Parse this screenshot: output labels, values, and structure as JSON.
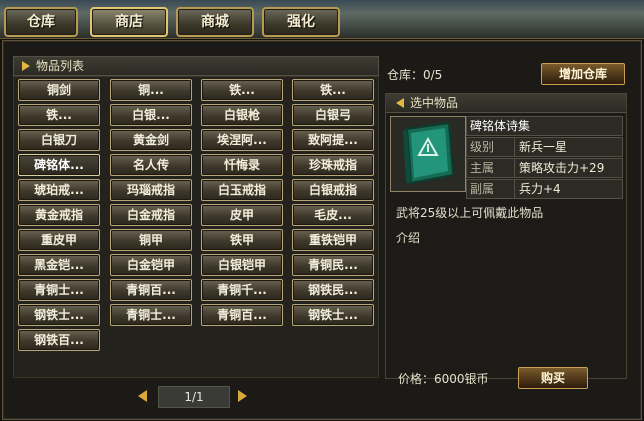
{
  "tabs": [
    {
      "label": "仓库"
    },
    {
      "label": "商店"
    },
    {
      "label": "商城"
    },
    {
      "label": "强化"
    }
  ],
  "list": {
    "header": "物品列表",
    "items": [
      "铜剑",
      "铜...",
      "铁...",
      "铁...",
      "铁...",
      "白银...",
      "白银枪",
      "白银弓",
      "白银刀",
      "黄金剑",
      "埃涅阿...",
      "致阿提...",
      "碑铭体...",
      "名人传",
      "忏悔录",
      "珍珠戒指",
      "琥珀戒...",
      "玛瑙戒指",
      "白玉戒指",
      "白银戒指",
      "黄金戒指",
      "白金戒指",
      "皮甲",
      "毛皮...",
      "重皮甲",
      "铜甲",
      "铁甲",
      "重铁铠甲",
      "黑金铠...",
      "白金铠甲",
      "白银铠甲",
      "青铜民...",
      "青铜士...",
      "青铜百...",
      "青铜千...",
      "钢铁民...",
      "钢铁士...",
      "青铜士...",
      "青铜百...",
      "钢铁士...",
      "钢铁百..."
    ]
  },
  "pager": {
    "text": "1/1"
  },
  "storage": {
    "label": "仓库：0/5",
    "button": "增加仓库"
  },
  "selected": {
    "header": "选中物品",
    "name": "碑铭体诗集",
    "rows": [
      {
        "key": "级别",
        "value": "新兵一星"
      },
      {
        "key": "主属",
        "value": "策略攻击力+29"
      },
      {
        "key": "副属",
        "value": "兵力+4"
      }
    ],
    "requirement": "武将25级以上可佩戴此物品",
    "intro": "介绍",
    "price": "价格：6000银币",
    "buy": "购买"
  },
  "colors": {
    "accent": "#e2b640",
    "button_border": "#b9a57a",
    "book": "#1f8a6e"
  }
}
